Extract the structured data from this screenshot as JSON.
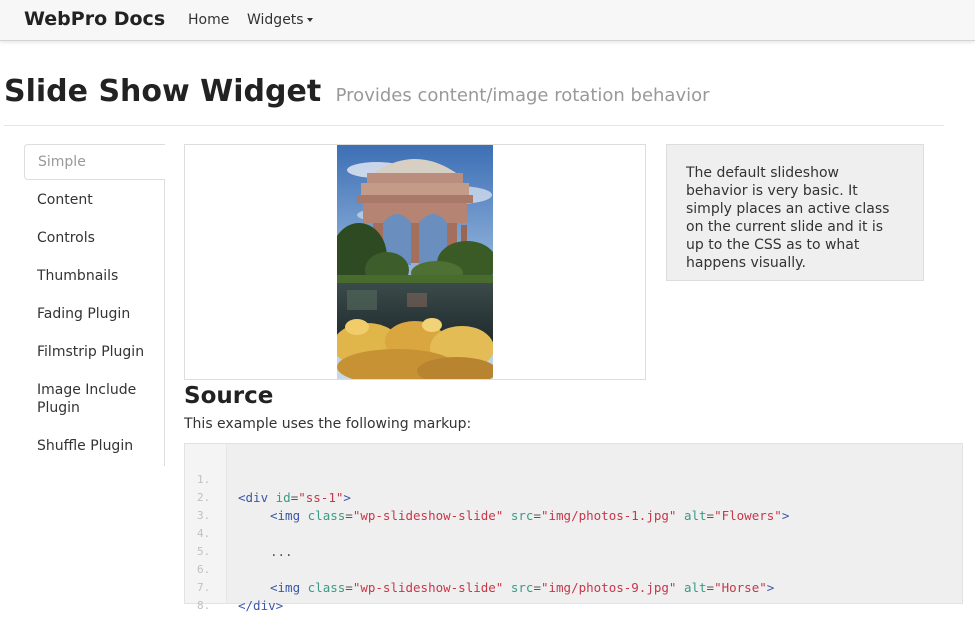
{
  "navbar": {
    "brand": "WebPro Docs",
    "links": [
      {
        "label": "Home"
      },
      {
        "label": "Widgets",
        "dropdown": true
      }
    ]
  },
  "page": {
    "title": "Slide Show Widget",
    "subtitle": "Provides content/image rotation behavior"
  },
  "sidenav": {
    "items": [
      {
        "label": "Simple",
        "active": true
      },
      {
        "label": "Content"
      },
      {
        "label": "Controls"
      },
      {
        "label": "Thumbnails"
      },
      {
        "label": "Fading Plugin"
      },
      {
        "label": "Filmstrip Plugin"
      },
      {
        "label": "Image Include Plugin"
      },
      {
        "label": "Shuffle Plugin"
      }
    ]
  },
  "info": {
    "text": "The default slideshow behavior is very basic. It simply places an active class on the current slide and it is up to the CSS as to what happens visually."
  },
  "source": {
    "heading": "Source",
    "description": "This example uses the following markup:",
    "line_numbers": [
      "1.",
      "2.",
      "3.",
      "4.",
      "5.",
      "6.",
      "7.",
      "8."
    ],
    "code": {
      "l1_open": "<div ",
      "l1_attr": "id",
      "l1_eq": "=",
      "l1_val": "\"ss-1\"",
      "l1_close": ">",
      "l2_open": "<img ",
      "l2_class_attr": "class",
      "l2_class_val": "\"wp-slideshow-slide\"",
      "l2_src_attr": "src",
      "l2_src_val": "\"img/photos-1.jpg\"",
      "l2_alt_attr": "alt",
      "l2_alt_val": "\"Flowers\"",
      "l2_close": ">",
      "l4_text": "...",
      "l6_open": "<img ",
      "l6_class_attr": "class",
      "l6_class_val": "\"wp-slideshow-slide\"",
      "l6_src_attr": "src",
      "l6_src_val": "\"img/photos-9.jpg\"",
      "l6_alt_attr": "alt",
      "l6_alt_val": "\"Horse\"",
      "l6_close": ">",
      "l7_text": "</div>",
      "eq": "=",
      "space": " "
    }
  },
  "colors": {
    "tag": "#3a57a8",
    "attribute": "#3a9a86",
    "string": "#c8364a",
    "line_number": "#c0c0c0",
    "code_background": "#efefef"
  }
}
